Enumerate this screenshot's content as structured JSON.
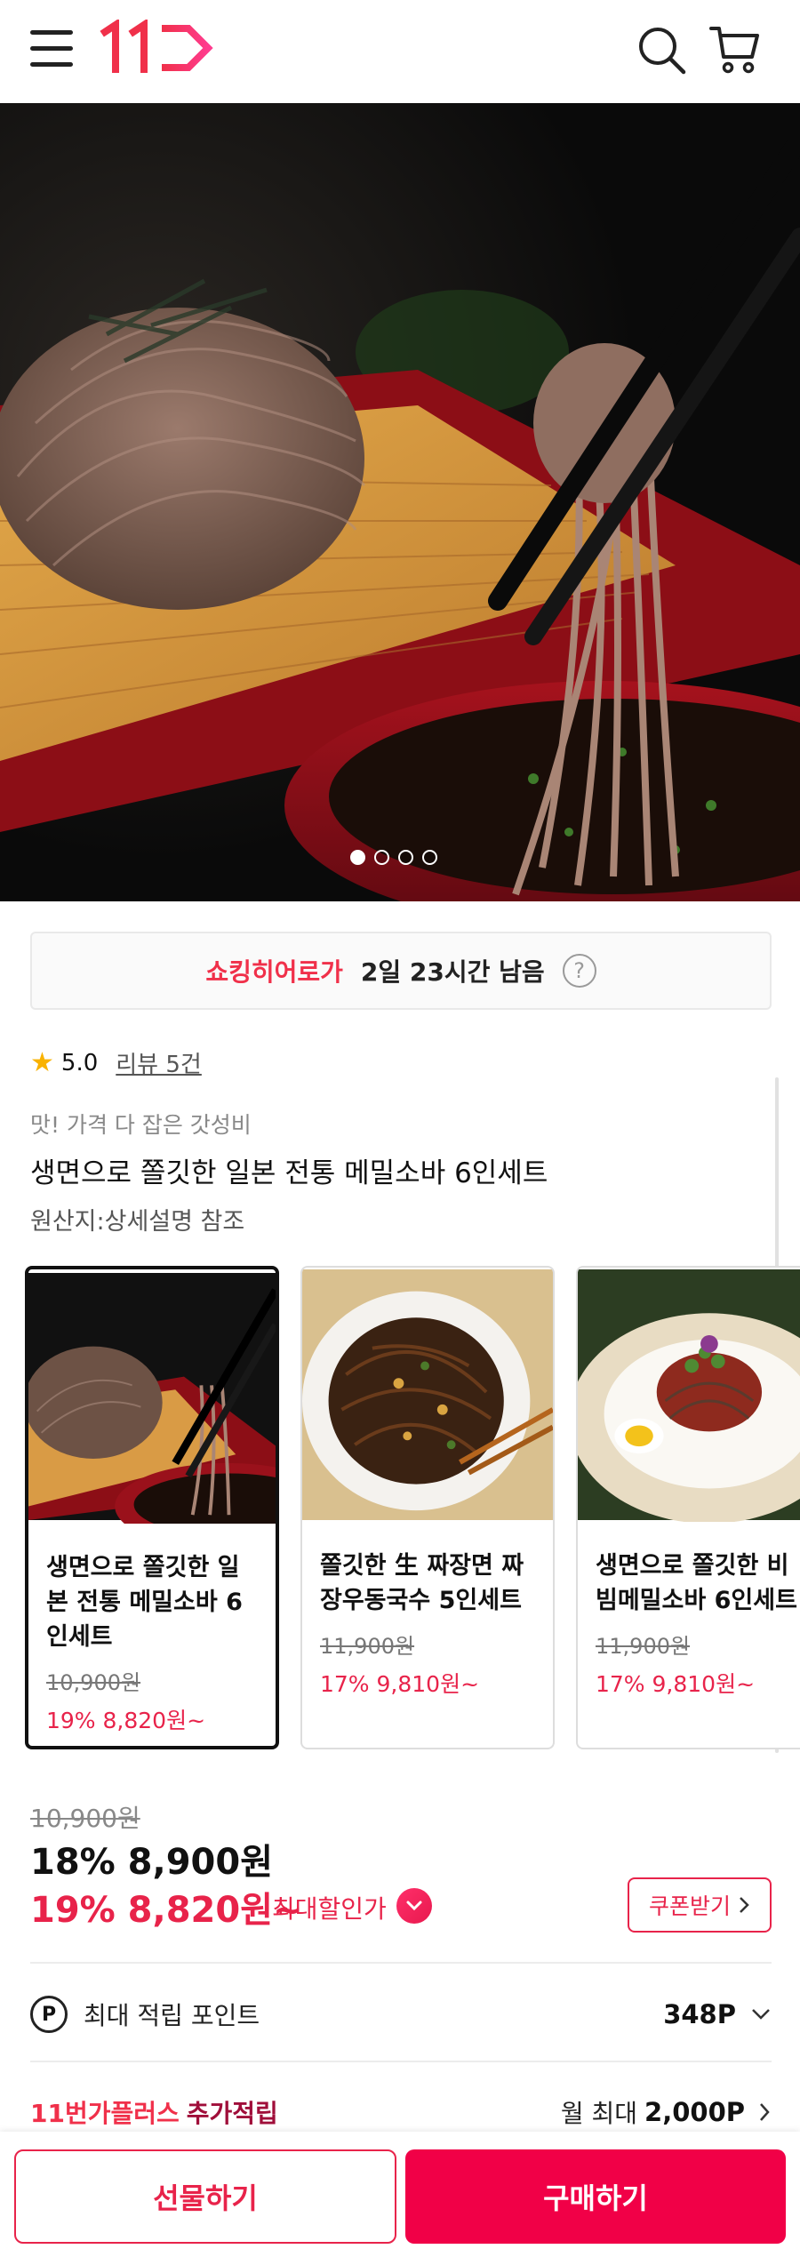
{
  "header": {
    "logo_text": "11",
    "menu_icon": "hamburger-icon",
    "search_icon": "search-icon",
    "cart_icon": "cart-icon"
  },
  "hero": {
    "image": "buckwheat soba noodles lifted with chopsticks over dipping sauce",
    "slide_count": 4,
    "active_slide": 1
  },
  "shocking": {
    "brand": "쇼킹히어로가",
    "remaining": "2일 23시간 남음",
    "help": "?"
  },
  "rating": {
    "score": "5.0",
    "review_label": "리뷰 5건"
  },
  "product": {
    "tagline": "맛! 가격 다 잡은 갓성비",
    "title": "생면으로 쫄깃한 일본 전통 메밀소바 6인세트",
    "origin": "원산지:상세설명 참조"
  },
  "options": [
    {
      "name": "생면으로 쫄깃한 일본 전통 메밀소바 6인세트",
      "orig": "10,900원",
      "sale": "19% 8,820원~",
      "selected": true
    },
    {
      "name": "쫄깃한 生 짜장면 짜장우동국수 5인세트",
      "orig": "11,900원",
      "sale": "17% 9,810원~",
      "selected": false
    },
    {
      "name": "생면으로 쫄깃한 비빔메밀소바 6인세트",
      "orig": "11,900원",
      "sale": "17% 9,810원~",
      "selected": false
    }
  ],
  "price": {
    "original": "10,900원",
    "main": "18% 8,900원",
    "max": "19% 8,820원~",
    "max_label": "최대할인가",
    "coupon": "쿠폰받기"
  },
  "points": {
    "icon": "P",
    "label": "최대 적립 포인트",
    "value": "348P"
  },
  "plus": {
    "brand": "11번가플러스",
    "extra": "추가적립",
    "monthly": "월 최대",
    "value": "2,000P"
  },
  "buttons": {
    "gift": "선물하기",
    "buy": "구매하기"
  },
  "colors": {
    "accent": "#f10047",
    "price_red": "#e8234a",
    "brand_red": "#f0304a"
  }
}
